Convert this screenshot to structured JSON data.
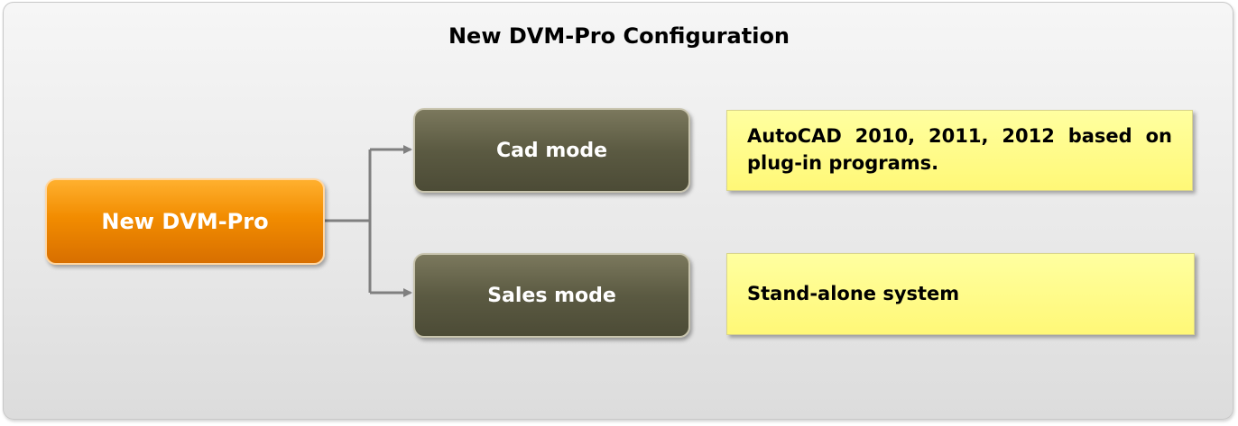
{
  "diagram": {
    "title": "New DVM-Pro Configuration",
    "root": {
      "label": "New DVM-Pro"
    },
    "modes": [
      {
        "label": "Cad mode",
        "description": "AutoCAD 2010, 2011, 2012 based on plug-in programs."
      },
      {
        "label": "Sales mode",
        "description": "Stand-alone system"
      }
    ]
  },
  "colors": {
    "root_fill": "#f28c00",
    "mode_fill": "#5b5a42",
    "note_fill": "#fff877",
    "connector": "#808080"
  }
}
